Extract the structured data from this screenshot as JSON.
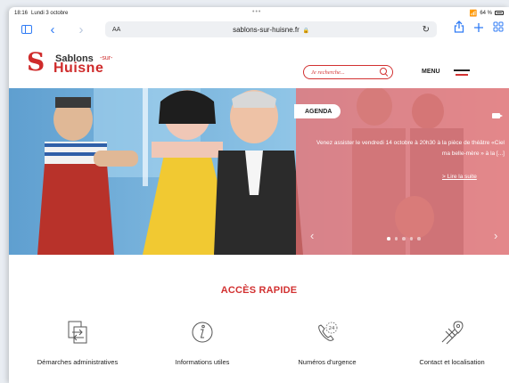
{
  "status_bar": {
    "time": "18:16",
    "date": "Lundi 3 octobre",
    "dots": "•••",
    "battery": "64 %"
  },
  "browser": {
    "aa_label": "AA",
    "url": "sablons-sur-huisne.fr",
    "accent_color": "#2f7bf5"
  },
  "site": {
    "logo": {
      "line1": "Sablons",
      "sur": "-sur-",
      "line2": "Huisne"
    },
    "search_placeholder": "Je recherche...",
    "menu_label": "MENU",
    "brand_color": "#d23131"
  },
  "hero": {
    "badge": "AGENDA",
    "text": "Venez assister le vendredi 14 octobre à 20h30 à la pièce de théâtre «Ciel ma belle-mère » à la [...]",
    "read_more": "> Lire la suite",
    "slide_count": 5,
    "active_slide": 0
  },
  "quick_access": {
    "title": "ACCÈS RAPIDE",
    "items": [
      {
        "label": "Démarches administratives",
        "icon": "documents-exchange-icon"
      },
      {
        "label": "Informations utiles",
        "icon": "info-icon"
      },
      {
        "label": "Numéros d'urgence",
        "icon": "phone-24-icon"
      },
      {
        "label": "Contact et localisation",
        "icon": "map-pin-road-icon"
      }
    ]
  }
}
